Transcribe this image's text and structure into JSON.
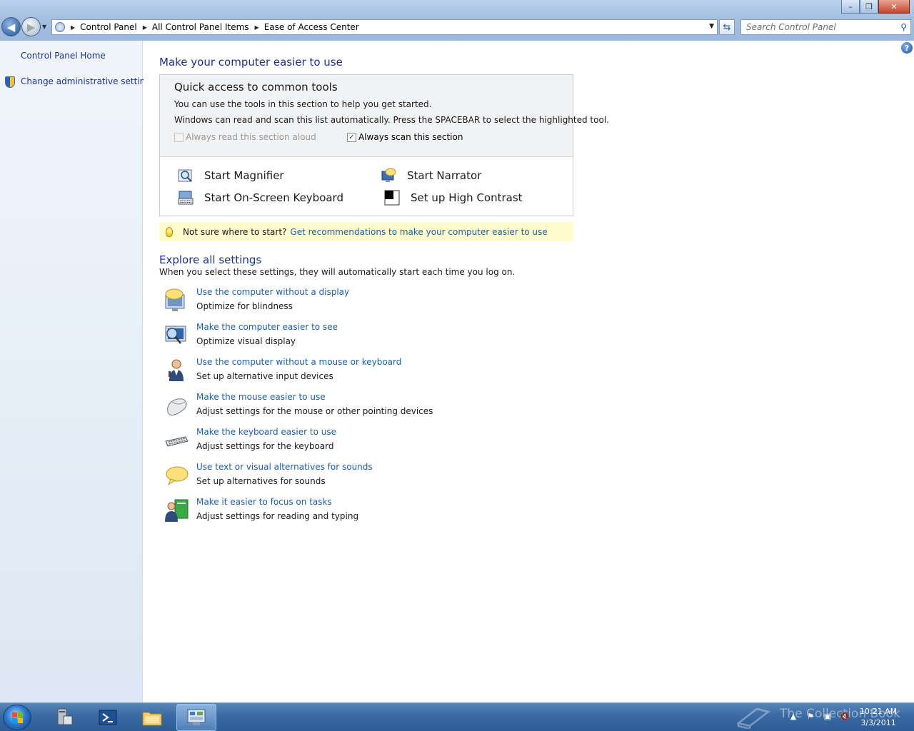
{
  "window": {
    "minimize": "–",
    "maximize": "❐",
    "close": "✕"
  },
  "address": {
    "crumbs": [
      "Control Panel",
      "All Control Panel Items",
      "Ease of Access Center"
    ]
  },
  "search": {
    "placeholder": "Search Control Panel"
  },
  "sidebar": {
    "items": [
      {
        "label": "Control Panel Home"
      },
      {
        "label": "Change administrative settings"
      }
    ]
  },
  "main": {
    "title": "Make your computer easier to use",
    "quick": {
      "title": "Quick access to common tools",
      "line1": "You can use the tools in this section to help you get started.",
      "line2": "Windows can read and scan this list automatically.  Press the SPACEBAR to select the highlighted tool.",
      "read_aloud": {
        "label": "Always read this section aloud",
        "checked": false,
        "enabled": false
      },
      "scan": {
        "label": "Always scan this section",
        "checked": true,
        "enabled": true
      },
      "tools": [
        {
          "label": "Start Magnifier",
          "icon": "magnifier-icon"
        },
        {
          "label": "Start Narrator",
          "icon": "narrator-icon"
        },
        {
          "label": "Start On-Screen Keyboard",
          "icon": "keyboard-icon"
        },
        {
          "label": "Set up High Contrast",
          "icon": "high-contrast-icon"
        }
      ]
    },
    "tip": {
      "label": "Not sure where to start?",
      "link": "Get recommendations to make your computer easier to use"
    },
    "explore": {
      "title": "Explore all settings",
      "subtitle": "When you select these settings, they will automatically start each time you log on.",
      "items": [
        {
          "link": "Use the computer without a display",
          "desc": "Optimize for blindness",
          "icon": "display-speech-icon"
        },
        {
          "link": "Make the computer easier to see",
          "desc": "Optimize visual display",
          "icon": "monitor-magnifier-icon"
        },
        {
          "link": "Use the computer without a mouse or keyboard",
          "desc": "Set up alternative input devices",
          "icon": "person-speaking-icon"
        },
        {
          "link": "Make the mouse easier to use",
          "desc": "Adjust settings for the mouse or other pointing devices",
          "icon": "mouse-icon"
        },
        {
          "link": "Make the keyboard easier to use",
          "desc": "Adjust settings for the keyboard",
          "icon": "keyboard-icon"
        },
        {
          "link": "Use text or visual alternatives for sounds",
          "desc": "Set up alternatives for sounds",
          "icon": "speech-bubble-icon"
        },
        {
          "link": "Make it easier to focus on tasks",
          "desc": "Adjust settings for reading and typing",
          "icon": "person-document-icon"
        }
      ]
    }
  },
  "taskbar": {
    "watermark": "The Collection Book",
    "time": "10:21 AM",
    "date": "3/3/2011"
  },
  "colors": {
    "link": "#1e5fa8",
    "heading": "#1e3287",
    "tip_bg": "#fffbcc",
    "taskbar": "#3a6aa3"
  }
}
